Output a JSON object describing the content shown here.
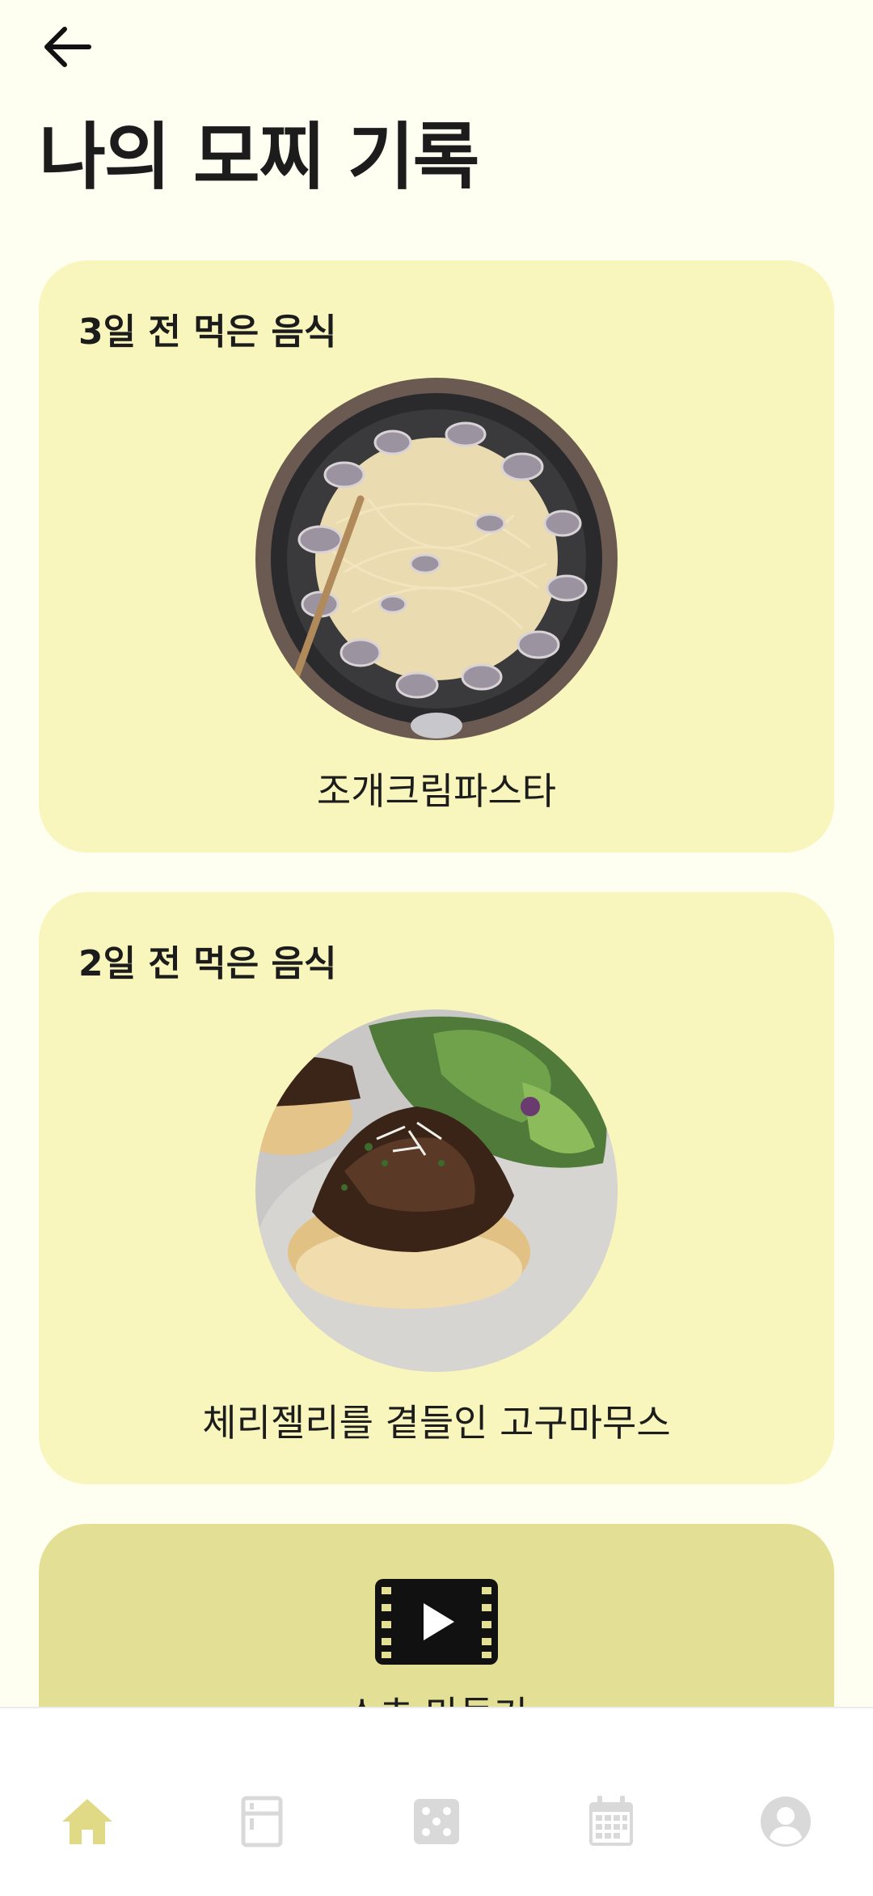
{
  "header": {
    "title": "나의 모찌 기록"
  },
  "records": [
    {
      "label": "3일 전 먹은 음식",
      "food": "조개크림파스타"
    },
    {
      "label": "2일 전 먹은 음식",
      "food": "체리젤리를 곁들인 고구마무스"
    }
  ],
  "shorts": {
    "label": "쇼츠 만들기"
  },
  "nav": {
    "active": "home",
    "items": [
      "home",
      "fridge",
      "dice",
      "calendar",
      "profile"
    ]
  },
  "colors": {
    "background": "#FEFEF1",
    "card": "#F8F6BC",
    "shorts_card": "#E3DF95",
    "nav_active": "#E0DA86",
    "nav_inactive": "#D9D9D9"
  }
}
